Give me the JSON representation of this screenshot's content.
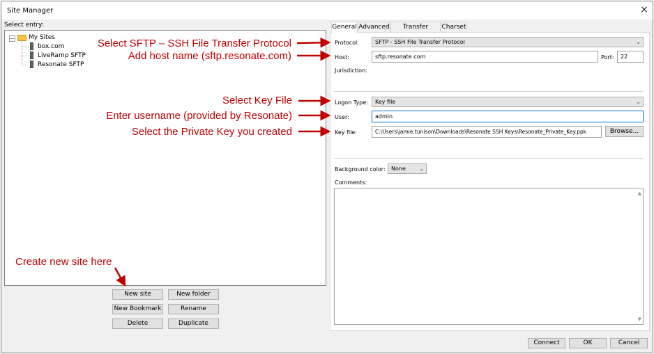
{
  "window": {
    "title": "Site Manager",
    "close_glyph": "×"
  },
  "left": {
    "select_entry_label": "Select entry:",
    "tree": {
      "root": {
        "label": "My Sites",
        "icon": "folder-icon",
        "expander": "−"
      },
      "children": [
        {
          "label": "box.com",
          "icon": "server-icon"
        },
        {
          "label": "LiveRamp SFTP",
          "icon": "server-icon"
        },
        {
          "label": "Resonate SFTP",
          "icon": "server-icon"
        }
      ]
    },
    "buttons": {
      "new_site": "New site",
      "new_folder": "New folder",
      "new_bookmark": "New Bookmark",
      "rename": "Rename",
      "delete": "Delete",
      "duplicate": "Duplicate"
    }
  },
  "tabs": [
    {
      "label": "General",
      "active": true
    },
    {
      "label": "Advanced",
      "active": false
    },
    {
      "label": "Transfer Settings",
      "active": false
    },
    {
      "label": "Charset",
      "active": false
    }
  ],
  "general": {
    "protocol_label": "Protocol:",
    "protocol_value": "SFTP - SSH File Transfer Protocol",
    "host_label": "Host:",
    "host_value": "sftp.resonate.com",
    "port_label": "Port:",
    "port_value": "22",
    "jurisdiction_label": "Jurisdiction:",
    "logon_type_label": "Logon Type:",
    "logon_type_value": "Key file",
    "user_label": "User:",
    "user_value": "admin",
    "key_file_label": "Key file:",
    "key_file_value": "C:\\Users\\jamie.tunison\\Downloads\\Resonate SSH Keys\\Resonate_Private_Key.ppk",
    "browse_label": "Browse...",
    "background_color_label": "Background color:",
    "background_color_value": "None",
    "comments_label": "Comments:"
  },
  "footer": {
    "connect": "Connect",
    "ok": "OK",
    "cancel": "Cancel"
  },
  "annotations": {
    "protocol": "Select SFTP – SSH File Transfer Protocol",
    "host": "Add host name (sftp.resonate.com)",
    "key_type": "Select Key File",
    "username": "Enter username (provided by Resonate)",
    "private_key": "Select the Private Key you created",
    "new_site": "Create new site here",
    "color": "#c00000"
  }
}
